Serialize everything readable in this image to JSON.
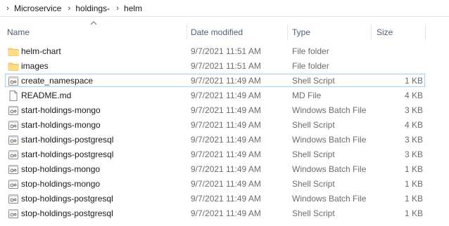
{
  "breadcrumb": {
    "items": [
      "Microservice",
      "holdings-",
      "helm"
    ]
  },
  "columns": {
    "name": "Name",
    "date": "Date modified",
    "type": "Type",
    "size": "Size"
  },
  "files": [
    {
      "name": "helm-chart",
      "date": "9/7/2021 11:51 AM",
      "type": "File folder",
      "size": "",
      "icon": "folder-icon"
    },
    {
      "name": "images",
      "date": "9/7/2021 11:51 AM",
      "type": "File folder",
      "size": "",
      "icon": "folder-icon"
    },
    {
      "name": "create_namespace",
      "date": "9/7/2021 11:49 AM",
      "type": "Shell Script",
      "size": "1 KB",
      "icon": "script-icon",
      "selected": true
    },
    {
      "name": "README.md",
      "date": "9/7/2021 11:49 AM",
      "type": "MD File",
      "size": "4 KB",
      "icon": "document-icon"
    },
    {
      "name": "start-holdings-mongo",
      "date": "9/7/2021 11:49 AM",
      "type": "Windows Batch File",
      "size": "3 KB",
      "icon": "batch-file-icon"
    },
    {
      "name": "start-holdings-mongo",
      "date": "9/7/2021 11:49 AM",
      "type": "Shell Script",
      "size": "4 KB",
      "icon": "script-icon"
    },
    {
      "name": "start-holdings-postgresql",
      "date": "9/7/2021 11:49 AM",
      "type": "Windows Batch File",
      "size": "3 KB",
      "icon": "batch-file-icon"
    },
    {
      "name": "start-holdings-postgresql",
      "date": "9/7/2021 11:49 AM",
      "type": "Shell Script",
      "size": "3 KB",
      "icon": "script-icon"
    },
    {
      "name": "stop-holdings-mongo",
      "date": "9/7/2021 11:49 AM",
      "type": "Windows Batch File",
      "size": "1 KB",
      "icon": "batch-file-icon"
    },
    {
      "name": "stop-holdings-mongo",
      "date": "9/7/2021 11:49 AM",
      "type": "Shell Script",
      "size": "1 KB",
      "icon": "script-icon"
    },
    {
      "name": "stop-holdings-postgresql",
      "date": "9/7/2021 11:49 AM",
      "type": "Windows Batch File",
      "size": "1 KB",
      "icon": "batch-file-icon"
    },
    {
      "name": "stop-holdings-postgresql",
      "date": "9/7/2021 11:49 AM",
      "type": "Shell Script",
      "size": "1 KB",
      "icon": "script-icon"
    }
  ],
  "colors": {
    "folder": "#f8d775",
    "selection_border": "#99d1ff",
    "header_text": "#4c607a"
  }
}
